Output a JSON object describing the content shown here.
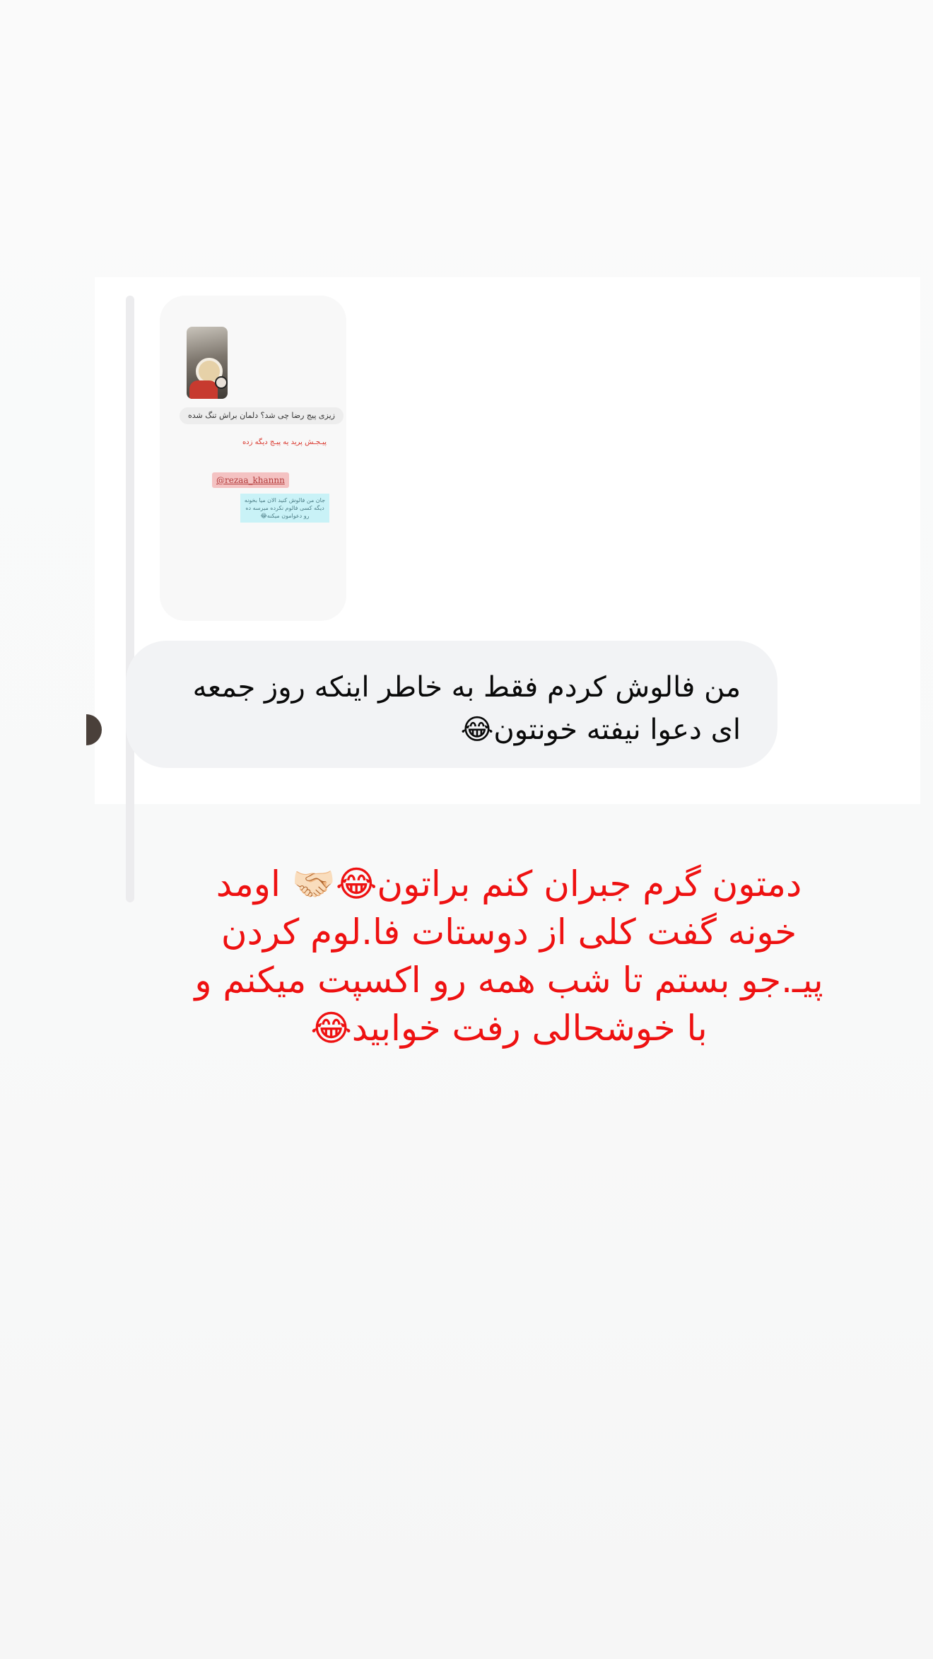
{
  "shared_story": {
    "caption": "زیزی پیج رضا چی شد؟ دلمان براش تنگ شده",
    "red_note": "پیـجـش پرید یه پیـج دیگه زده",
    "mention": "@rezaa_khannn",
    "cyan_note": "جان من فالوش کنید الان میا بخونه دیگه کسی فالوم نکرده میرسه ده رو دعوامون میکنه😂"
  },
  "message": {
    "text": "من فالوش کردم فقط به خاطر اینکه روز جمعه ای دعوا نیفته خونتون😂"
  },
  "overlay": {
    "text": "دمتون گرم جبران کنم براتون😂🤝🏻 اومد خونه گفت کلی از دوستات فا.لوم کردن پیـ.جو بستم تا شب همه رو اکسپت میکنم و با خوشحالی رفت خوابید😂"
  },
  "colors": {
    "overlay_text": "#ee1111",
    "bubble": "#f2f3f5",
    "mention_bg": "#f4c2c2",
    "cyan_note_bg": "#c9f2f7"
  },
  "icons": {
    "avatar": "avatar",
    "story_thumb": "image-thumbnail"
  }
}
